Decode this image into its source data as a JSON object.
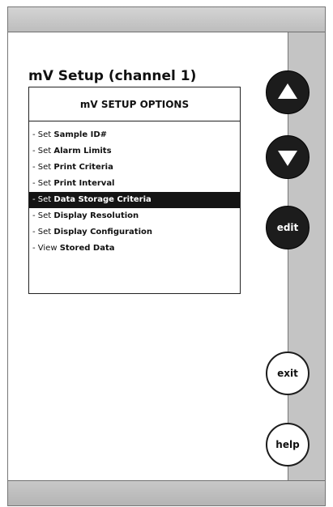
{
  "screen": {
    "title": "mV Setup (channel 1)"
  },
  "menu": {
    "header": "mV SETUP OPTIONS",
    "selected_index": 4,
    "items": [
      {
        "prefix": "- Set ",
        "label": "Sample ID#"
      },
      {
        "prefix": "- Set ",
        "label": "Alarm Limits"
      },
      {
        "prefix": "- Set ",
        "label": "Print Criteria"
      },
      {
        "prefix": "- Set ",
        "label": "Print Interval"
      },
      {
        "prefix": "- Set ",
        "label": "Data Storage Criteria"
      },
      {
        "prefix": "- Set ",
        "label": "Display Resolution"
      },
      {
        "prefix": "- Set ",
        "label": "Display Configuration"
      },
      {
        "prefix": "- View ",
        "label": "Stored Data"
      }
    ]
  },
  "buttons": {
    "up_icon": "up-arrow-icon",
    "down_icon": "down-arrow-icon",
    "edit": "edit",
    "exit": "exit",
    "help": "help"
  },
  "colors": {
    "selected_bg": "#141414",
    "button_dark": "#1c1c1c",
    "panel_gray": "#c4c4c4"
  }
}
